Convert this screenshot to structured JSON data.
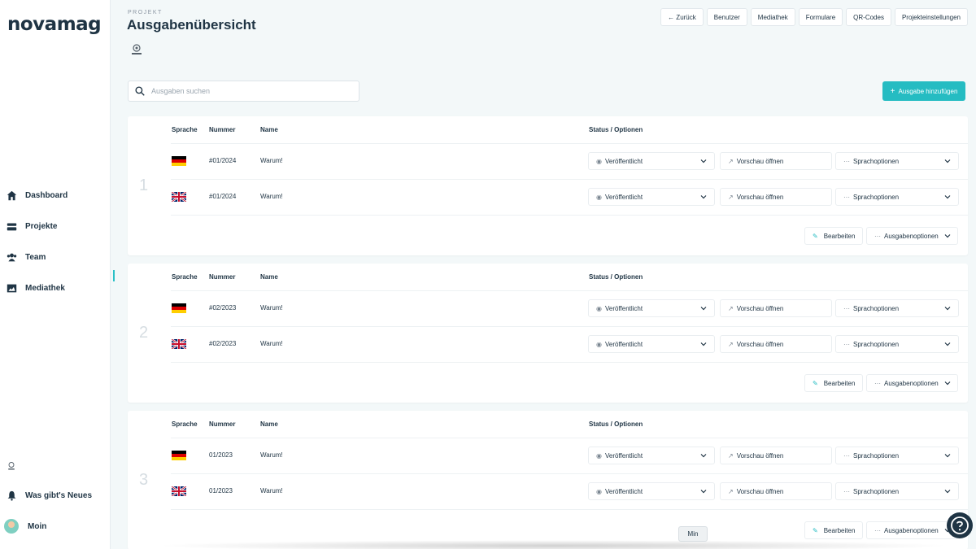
{
  "brand": "novamag",
  "sidebar": {
    "items": [
      {
        "label": "Dashboard",
        "icon": "home-icon"
      },
      {
        "label": "Projekte",
        "icon": "projects-icon"
      },
      {
        "label": "Team",
        "icon": "team-icon"
      },
      {
        "label": "Mediathek",
        "icon": "image-icon"
      }
    ],
    "news_label": "Was gibt's Neues",
    "user_name": "Moin"
  },
  "header": {
    "kicker": "PROJEKT",
    "title": "Ausgabenübersicht",
    "nav": [
      "← Zurück",
      "Benutzer",
      "Mediathek",
      "Formulare",
      "QR-Codes",
      "Projekteinstellungen"
    ]
  },
  "search": {
    "placeholder": "Ausgaben suchen"
  },
  "add_button": "Ausgabe hinzufügen",
  "columns": {
    "language": "Sprache",
    "number": "Nummer",
    "name": "Name",
    "status": "Status / Optionen"
  },
  "controls": {
    "status": "Veröffentlicht",
    "preview": "Vorschau öffnen",
    "lang_options": "Sprachoptionen",
    "edit": "Bearbeiten",
    "issue_options": "Ausgabenoptionen"
  },
  "issues": [
    {
      "index": "1",
      "rows": [
        {
          "flag": "de",
          "number": "#01/2024",
          "name": "Warum!"
        },
        {
          "flag": "gb",
          "number": "#01/2024",
          "name": "Warum!"
        }
      ]
    },
    {
      "index": "2",
      "rows": [
        {
          "flag": "de",
          "number": "#02/2023",
          "name": "Warum!"
        },
        {
          "flag": "gb",
          "number": "#02/2023",
          "name": "Warum!"
        }
      ]
    },
    {
      "index": "3",
      "rows": [
        {
          "flag": "de",
          "number": "01/2023",
          "name": "Warum!"
        },
        {
          "flag": "gb",
          "number": "01/2023",
          "name": "Warum!"
        }
      ]
    }
  ],
  "tooltip": "Min",
  "colors": {
    "accent": "#25bcc2",
    "text": "#1f3444",
    "background": "#f3f8f9"
  }
}
